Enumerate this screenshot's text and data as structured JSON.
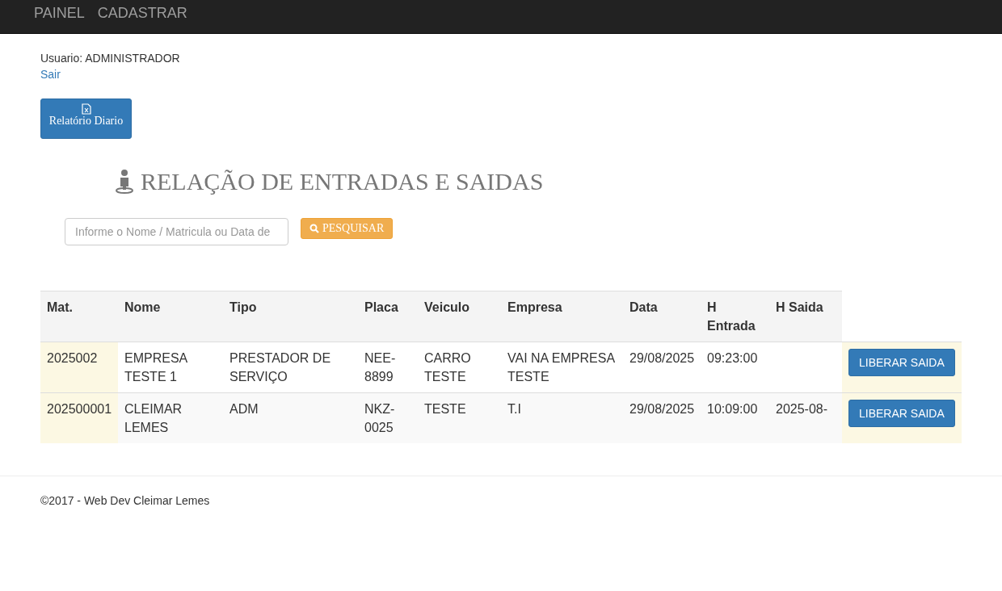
{
  "navbar": {
    "links": [
      "PAINEL",
      "CADASTRAR"
    ]
  },
  "user": {
    "label": "Usuario: ADMINISTRADOR",
    "logout": "Sair"
  },
  "report_button": "Relatório Diario",
  "title": "RELAÇÃO DE ENTRADAS E SAIDAS",
  "search": {
    "placeholder": "Informe o Nome / Matricula ou Data de",
    "button": "PESQUISAR"
  },
  "table": {
    "columns": [
      "Mat.",
      "Nome",
      "Tipo",
      "Placa",
      "Veiculo",
      "Empresa",
      "Data",
      "H Entrada",
      "H Saida"
    ],
    "rows": [
      {
        "cells": [
          "2025002",
          "EMPRESA TESTE 1",
          "PRESTADOR DE SERVIÇO",
          "NEE-8899",
          "CARRO TESTE",
          "VAI NA EMPRESA TESTE",
          "29/08/2025",
          "09:23:00",
          ""
        ],
        "action": "LIBERAR SAIDA"
      },
      {
        "cells": [
          "202500001",
          "CLEIMAR LEMES",
          "ADM",
          "NKZ-0025",
          "TESTE",
          "T.I",
          "29/08/2025",
          "10:09:00",
          "2025-08-"
        ],
        "action": "LIBERAR SAIDA"
      }
    ]
  },
  "footer": "©2017 - Web Dev Cleimar Lemes"
}
